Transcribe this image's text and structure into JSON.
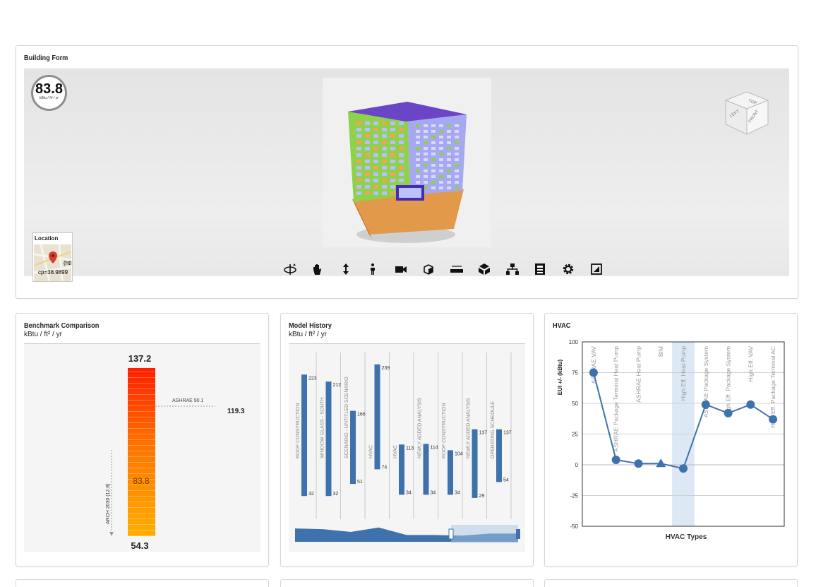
{
  "building_form": {
    "title": "Building Form",
    "eui": {
      "value": "83.8",
      "unit": "kBtu / ft² / yr"
    },
    "location": {
      "title": "Location",
      "url_fragment": "(htt",
      "cp_text": "cp=38.9899"
    },
    "viewcube": {
      "top": "TOP",
      "left": "LEFT",
      "front": "FRONT"
    },
    "toolbar": [
      "orbit-icon",
      "pan-icon",
      "zoom-icon",
      "walk-icon",
      "camera-icon",
      "section-icon",
      "measure-icon",
      "explode-icon",
      "model-browser-icon",
      "properties-icon",
      "settings-icon",
      "fullscreen-icon"
    ]
  },
  "benchmark": {
    "title": "Benchmark Comparison",
    "unit": "kBtu / ft² / yr",
    "max_label": "137.2",
    "min_label": "54.3",
    "current_label": "83.8",
    "ashrae_label": "ASHRAE 90.1",
    "ashrae_value": "119.3",
    "arch_label": "ARCH 2030 (12.8)",
    "colors": {
      "top": "#ff1e00",
      "mid": "#ff8a00",
      "bottom": "#ffb300"
    }
  },
  "model_history": {
    "title": "Model History",
    "unit": "kBtu / ft² / yr",
    "chart_data": {
      "type": "bar",
      "categories": [
        "ROOF CONSTRUCTION",
        "WINDOW GLASS - SOUTH",
        "SCENARIO - UNTITLED SCENARIO",
        "HVAC",
        "HVAC",
        "NEWLY ADDED ANALYSIS",
        "ROOF CONSTRUCTION",
        "NEWLY ADDED ANALYSIS",
        "OPERATING SCHEDULE"
      ],
      "high": [
        223,
        212,
        166,
        239,
        113,
        114,
        104,
        137,
        137
      ],
      "low": [
        32,
        32,
        51,
        74,
        34,
        34,
        34,
        29,
        54
      ],
      "ylim": [
        0,
        260
      ],
      "color": "#3f72ad"
    }
  },
  "hvac": {
    "title": "HVAC",
    "chart_data": {
      "type": "line",
      "categories": [
        "ASHRAE VAV",
        "ASHRAE Package Terminal Heat Pump",
        "ASHRAE Heat Pump",
        "BIM",
        "High Eff. Heat Pump",
        "ASHRAE Package System",
        "High Eff. Package System",
        "High Eff. VAV",
        "High Eff. Package Terminal AC"
      ],
      "values": [
        75,
        4,
        1,
        1,
        -3,
        49,
        42,
        49,
        37
      ],
      "baseline_index": 3,
      "highlight_index": 4,
      "ylabel": "EUI +/- (kBtu)",
      "xlabel": "HVAC Types",
      "ylim": [
        -50,
        100
      ],
      "yticks": [
        100,
        75,
        50,
        25,
        0,
        -25,
        -50
      ],
      "color": "#3f72ad",
      "highlight_color": "#dde8f5"
    }
  }
}
